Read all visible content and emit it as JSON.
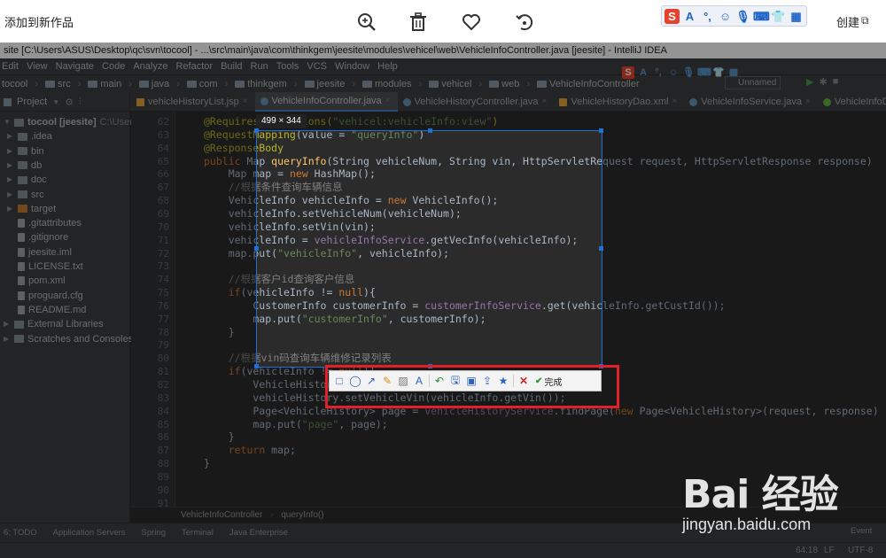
{
  "viewer": {
    "title": "添加到新作品",
    "create_label": "创建",
    "restore_glyph": "⧉"
  },
  "sogou_bar": {
    "items": [
      "S",
      "A",
      "°,",
      "☺",
      "mic",
      "kbd",
      "shirt",
      "grid"
    ]
  },
  "ide": {
    "window_title": "site [C:\\Users\\ASUS\\Desktop\\qc\\svn\\tocool] - ...\\src\\main\\java\\com\\thinkgem\\jeesite\\modules\\vehicel\\web\\VehicleInfoController.java [jeesite] - IntelliJ IDEA",
    "menu": [
      "Edit",
      "View",
      "Navigate",
      "Code",
      "Analyze",
      "Refactor",
      "Build",
      "Run",
      "Tools",
      "VCS",
      "Window",
      "Help"
    ],
    "nav": [
      "tocool",
      "src",
      "main",
      "java",
      "com",
      "thinkgem",
      "jeesite",
      "modules",
      "vehicel",
      "web",
      "VehicleInfoController"
    ],
    "run_config": "Unnamed",
    "project_label": "Project",
    "tabs": [
      {
        "label": "vehicleHistoryList.jsp",
        "type": "x",
        "active": false
      },
      {
        "label": "VehicleInfoController.java",
        "type": "c",
        "active": true
      },
      {
        "label": "VehicleHistoryController.java",
        "type": "c",
        "active": false
      },
      {
        "label": "VehicleHistoryDao.xml",
        "type": "x",
        "active": false
      },
      {
        "label": "VehicleInfoService.java",
        "type": "c",
        "active": false
      },
      {
        "label": "VehicleInfoDao.java",
        "type": "i",
        "active": false
      }
    ],
    "tree": [
      {
        "label": "tocool [jeesite]",
        "hint": "C:\\Users\\AS",
        "kind": "root",
        "indent": 0
      },
      {
        "label": ".idea",
        "kind": "folder",
        "indent": 1
      },
      {
        "label": "bin",
        "kind": "folder",
        "indent": 1
      },
      {
        "label": "db",
        "kind": "folder",
        "indent": 1
      },
      {
        "label": "doc",
        "kind": "folder",
        "indent": 1
      },
      {
        "label": "src",
        "kind": "folder",
        "indent": 1
      },
      {
        "label": "target",
        "kind": "folder-orange",
        "indent": 1
      },
      {
        "label": ".gitattributes",
        "kind": "file",
        "indent": 1
      },
      {
        "label": ".gitignore",
        "kind": "file",
        "indent": 1
      },
      {
        "label": "jeesite.iml",
        "kind": "file",
        "indent": 1
      },
      {
        "label": "LICENSE.txt",
        "kind": "file",
        "indent": 1
      },
      {
        "label": "pom.xml",
        "kind": "file",
        "indent": 1
      },
      {
        "label": "proguard.cfg",
        "kind": "file",
        "indent": 1
      },
      {
        "label": "README.md",
        "kind": "file",
        "indent": 1
      },
      {
        "label": "External Libraries",
        "kind": "lib",
        "indent": 0
      },
      {
        "label": "Scratches and Consoles",
        "kind": "lib",
        "indent": 0
      }
    ],
    "line_numbers": [
      "62",
      "63",
      "64",
      "65",
      "66",
      "67",
      "68",
      "69",
      "70",
      "71",
      "72",
      "73",
      "74",
      "75",
      "76",
      "77",
      "78",
      "79",
      "80",
      "81",
      "82",
      "83",
      "84",
      "85",
      "86",
      "87",
      "88",
      "89",
      "90",
      "91"
    ],
    "code_lines": [
      [
        {
          "t": "@RequiresPermissions(",
          "c": "an"
        },
        {
          "t": "\"vehicel:vehicleInfo:view\"",
          "c": "st"
        },
        {
          "t": ")",
          "c": "an"
        }
      ],
      [
        {
          "t": "@RequestMapping",
          "c": "an"
        },
        {
          "t": "(value = ",
          "c": ""
        },
        {
          "t": "\"queryInfo\"",
          "c": "st"
        },
        {
          "t": ")",
          "c": ""
        }
      ],
      [
        {
          "t": "@ResponseBody",
          "c": "an"
        }
      ],
      [
        {
          "t": "public ",
          "c": "kw"
        },
        {
          "t": "Map ",
          "c": ""
        },
        {
          "t": "queryInfo",
          "c": "mt"
        },
        {
          "t": "(String vehicleNum, String vin, HttpServletRequest request, HttpServletResponse response)",
          "c": ""
        }
      ],
      [
        {
          "t": "    Map map = ",
          "c": ""
        },
        {
          "t": "new ",
          "c": "kw"
        },
        {
          "t": "HashMap();",
          "c": ""
        }
      ],
      [
        {
          "t": "    //根据条件查询车辆信息",
          "c": "cm"
        }
      ],
      [
        {
          "t": "    VehicleInfo vehicleInfo = ",
          "c": ""
        },
        {
          "t": "new ",
          "c": "kw"
        },
        {
          "t": "VehicleInfo();",
          "c": ""
        }
      ],
      [
        {
          "t": "    vehicleInfo.setVehicleNum(vehicleNum);",
          "c": ""
        }
      ],
      [
        {
          "t": "    vehicleInfo.setVin(vin);",
          "c": ""
        }
      ],
      [
        {
          "t": "    vehicleInfo = ",
          "c": ""
        },
        {
          "t": "vehicleInfoService",
          "c": "fd"
        },
        {
          "t": ".getVecInfo(vehicleInfo);",
          "c": ""
        }
      ],
      [
        {
          "t": "    map.put(",
          "c": ""
        },
        {
          "t": "\"vehicleInfo\"",
          "c": "st"
        },
        {
          "t": ", vehicleInfo);",
          "c": ""
        }
      ],
      [
        {
          "t": "",
          "c": ""
        }
      ],
      [
        {
          "t": "    //根据客户id查询客户信息",
          "c": "cm"
        }
      ],
      [
        {
          "t": "    ",
          "c": ""
        },
        {
          "t": "if",
          "c": "kw"
        },
        {
          "t": "(vehicleInfo != ",
          "c": ""
        },
        {
          "t": "null",
          "c": "kw"
        },
        {
          "t": "){",
          "c": ""
        }
      ],
      [
        {
          "t": "        CustomerInfo customerInfo = ",
          "c": ""
        },
        {
          "t": "customerInfoService",
          "c": "fd"
        },
        {
          "t": ".get(vehicleInfo.getCustId());",
          "c": ""
        }
      ],
      [
        {
          "t": "        map.put(",
          "c": ""
        },
        {
          "t": "\"customerInfo\"",
          "c": "st"
        },
        {
          "t": ", customerInfo);",
          "c": ""
        }
      ],
      [
        {
          "t": "    }",
          "c": ""
        }
      ],
      [
        {
          "t": "",
          "c": ""
        }
      ],
      [
        {
          "t": "    //根据vin码查询车辆维修记录列表",
          "c": "cm"
        }
      ],
      [
        {
          "t": "    ",
          "c": ""
        },
        {
          "t": "if",
          "c": "kw"
        },
        {
          "t": "(vehicleInfo != ",
          "c": ""
        },
        {
          "t": "null",
          "c": "kw"
        },
        {
          "t": "){",
          "c": ""
        }
      ],
      [
        {
          "t": "        VehicleHistory vehicleHistory = ",
          "c": ""
        },
        {
          "t": "new ",
          "c": "kw"
        },
        {
          "t": "VehicleHistory();",
          "c": ""
        }
      ],
      [
        {
          "t": "        vehicleHistory.setVehicleVin(vehicleInfo.getVin());",
          "c": ""
        }
      ],
      [
        {
          "t": "        Page<VehicleHistory> page = ",
          "c": ""
        },
        {
          "t": "vehicleHistoryService",
          "c": "fd"
        },
        {
          "t": ".findPage(",
          "c": ""
        },
        {
          "t": "new ",
          "c": "kw"
        },
        {
          "t": "Page<VehicleHistory>(request, response)",
          "c": ""
        }
      ],
      [
        {
          "t": "        map.put(",
          "c": ""
        },
        {
          "t": "\"page\"",
          "c": "st"
        },
        {
          "t": ", page);",
          "c": ""
        }
      ],
      [
        {
          "t": "    }",
          "c": ""
        }
      ],
      [
        {
          "t": "    ",
          "c": ""
        },
        {
          "t": "return ",
          "c": "kw"
        },
        {
          "t": "map;",
          "c": ""
        }
      ],
      [
        {
          "t": "}",
          "c": ""
        }
      ],
      [
        {
          "t": "",
          "c": ""
        }
      ],
      [
        {
          "t": "",
          "c": ""
        }
      ],
      [
        {
          "t": "",
          "c": ""
        }
      ]
    ],
    "breadcrumb": [
      "VehicleInfoController",
      "queryInfo()"
    ],
    "tool_windows": [
      "6: TODO",
      "Application Servers",
      "Spring",
      "Terminal",
      "Java Enterprise"
    ],
    "event_log": "Event",
    "status": {
      "position": "64:18",
      "line_sep": "LF",
      "encoding": "UTF-8"
    }
  },
  "screenshot_tool": {
    "size_label": "499 × 344",
    "tools": [
      "rect",
      "ellipse",
      "arrow",
      "pen",
      "mosaic",
      "text",
      "undo",
      "save",
      "copy",
      "share",
      "pin",
      "cancel"
    ],
    "done_label": "完成"
  },
  "watermark": {
    "brand": "Bai 经验",
    "url": "jingyan.baidu.com"
  }
}
